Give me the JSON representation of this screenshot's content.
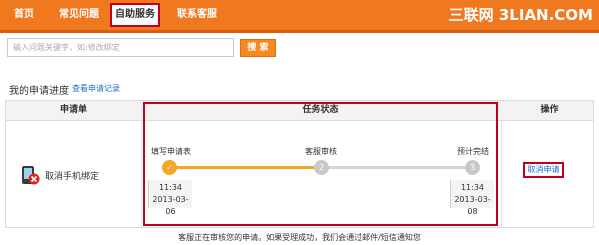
{
  "nav": {
    "items": [
      {
        "label": "首页"
      },
      {
        "label": "常见问题"
      },
      {
        "label": "自助服务",
        "active": true
      },
      {
        "label": "联系客服"
      }
    ],
    "brand": "三联网 3LIAN.COM"
  },
  "search": {
    "placeholder": "输入问题关键字，如:修改绑定",
    "button_label": "搜 索"
  },
  "progress": {
    "title": "我的申请进度",
    "history_link": "查看申请记录"
  },
  "table": {
    "headers": {
      "form": "申请单",
      "status": "任务状态",
      "action": "操作"
    },
    "row": {
      "item_name": "取消手机绑定",
      "icon": "phone-cancel-icon",
      "steps": [
        {
          "label": "填写申请表",
          "marker": "✓",
          "state": "done",
          "time": "11:34",
          "date": "2013-03-06"
        },
        {
          "label": "客服审核",
          "marker": "2",
          "state": "pending"
        },
        {
          "label": "预计完结",
          "marker": "3",
          "state": "pending",
          "time": "11:34",
          "date": "2013-03-08"
        }
      ],
      "action_label": "取消申请"
    }
  },
  "notice": "客服正在审核您的申请。如果受理成功，我们会通过邮件/短信通知您",
  "colors": {
    "nav_bg": "#f0781e",
    "highlight": "#c3001c",
    "step_done": "#f5a623",
    "step_pending": "#cccccc",
    "link": "#1d6fc5"
  }
}
